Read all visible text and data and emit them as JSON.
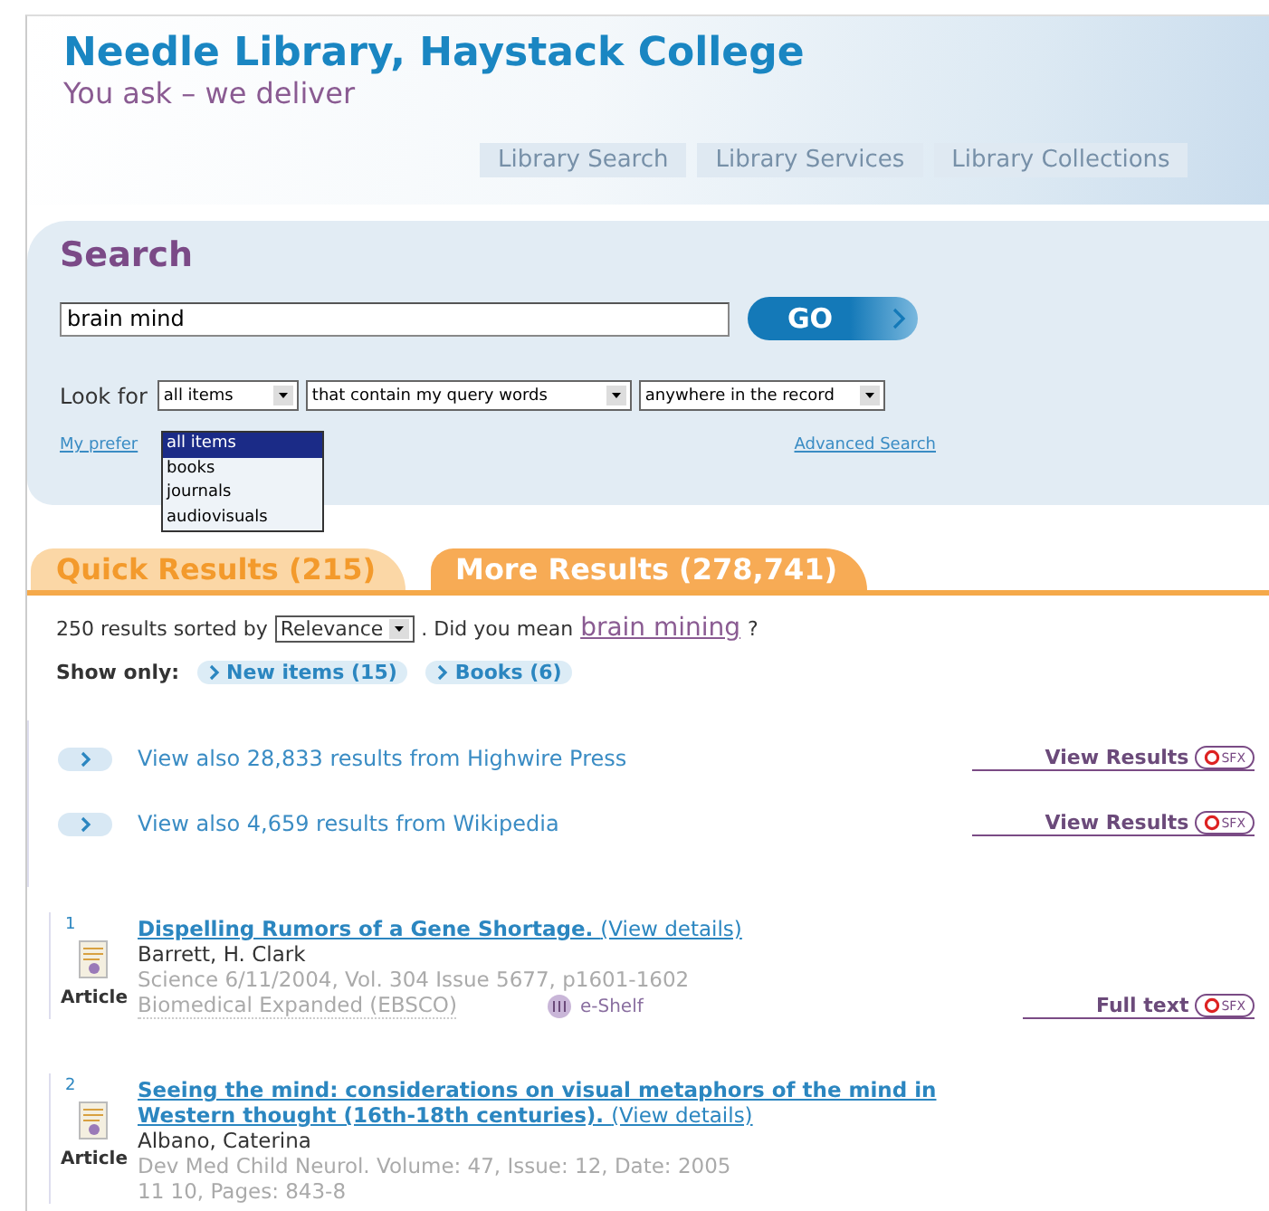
{
  "header": {
    "title": "Needle Library, Haystack College",
    "tagline": "You ask – we deliver"
  },
  "nav_tabs": [
    {
      "label": "Library Search"
    },
    {
      "label": "Library Services"
    },
    {
      "label": "Library Collections"
    }
  ],
  "search": {
    "title": "Search",
    "query": "brain mind",
    "go_button": "GO",
    "look_for_label": "Look for",
    "selects": [
      "all items",
      "that contain my query words",
      "anywhere in the record"
    ],
    "dropdown_options": [
      {
        "label": "all items",
        "selected": true
      },
      {
        "label": "books",
        "selected": false
      },
      {
        "label": "journals",
        "selected": false
      },
      {
        "label": "audiovisuals",
        "selected": false
      }
    ],
    "preferences_link": "My prefer",
    "advanced_link": "Advanced Search"
  },
  "result_tabs": [
    {
      "label": "Quick Results (215)",
      "selected": false
    },
    {
      "label": "More Results (278,741)",
      "selected": true
    }
  ],
  "sort": {
    "prefix": "250 results sorted by",
    "select": "Relevance",
    "did_you_mean": ". Did you mean",
    "suggestion": "brain mining",
    "suffix": "?"
  },
  "show_only": {
    "label": "Show only:",
    "filters": [
      "New items (15)",
      "Books (6)"
    ]
  },
  "external": [
    {
      "text": "View also 28,833 results from Highwire Press",
      "action": "View Results",
      "badge": "SFX"
    },
    {
      "text": "View also 4,659 results from Wikipedia",
      "action": "View Results",
      "badge": "SFX"
    }
  ],
  "results": [
    {
      "number": "1",
      "type": "Article",
      "title": "Dispelling Rumors of a Gene Shortage.",
      "details_link": "(View details)",
      "author": "Barrett, H. Clark",
      "source": "Science 6/11/2004, Vol. 304 Issue 5677, p1601-1602",
      "database": "Biomedical Expanded (EBSCO)",
      "eshelf": "e-Shelf",
      "action": "Full text",
      "badge": "SFX"
    },
    {
      "number": "2",
      "type": "Article",
      "title": "Seeing the mind: considerations on visual metaphors of the mind in Western thought (16th-18th centuries).",
      "details_link": "(View details)",
      "author": "Albano, Caterina",
      "source": "Dev Med Child Neurol. Volume: 47, Issue: 12, Date: 2005 11 10, Pages: 843-8"
    }
  ]
}
